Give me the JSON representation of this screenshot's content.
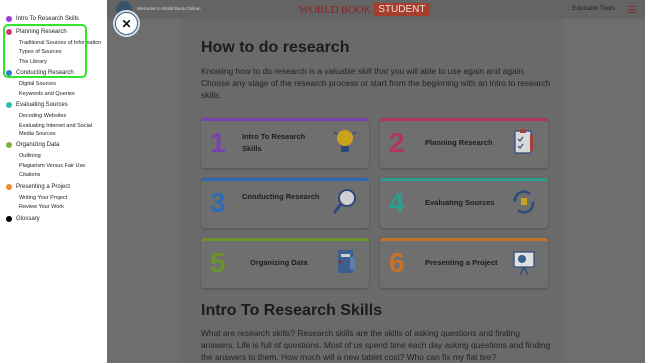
{
  "sidebar": {
    "sections": [
      {
        "label": "Intro To Research Skills",
        "color": "#9b3fd6",
        "items": []
      },
      {
        "label": "Planning Research",
        "color": "#d6357a",
        "items": [
          "Traditional Sources of Information",
          "Types of Sources",
          "The Library"
        ]
      },
      {
        "label": "Conducting Research",
        "color": "#2f7ad6",
        "items": [
          "Digital Sources",
          "Keywords and Queries"
        ]
      },
      {
        "label": "Evaluating Sources",
        "color": "#2bbfad",
        "items": [
          "Decoding Websites",
          "Evaluating Internet and Social Media Sources"
        ]
      },
      {
        "label": "Organizing Data",
        "color": "#7fb03a",
        "items": [
          "Outlining",
          "Plagiarism Versus Fair Use",
          "Citations"
        ]
      },
      {
        "label": "Presenting a Project",
        "color": "#ef8a2e",
        "items": [
          "Writing Your Project",
          "Review Your Work"
        ]
      },
      {
        "label": "Glossary",
        "color": "#000000",
        "items": []
      }
    ]
  },
  "topbar": {
    "welcome": "Welcome to World Book Online!",
    "brand": "WORLD BOOK",
    "brand_badge": "STUDENT",
    "educator_tools": "Educator Tools"
  },
  "close_label": "✕",
  "main": {
    "title": "How to do research",
    "intro": "Knowing how to do research is a valuable skill that you will able to use again and again. Choose any stage of the research process or start from the beginning with an intro to research skills.",
    "cards": [
      {
        "number": "1",
        "label": "Intro To Research Skills",
        "color": "#7a3fb0",
        "icon": "lightbulb-icon"
      },
      {
        "number": "2",
        "label": "Planning Research",
        "color": "#b0355f",
        "icon": "clipboard-icon"
      },
      {
        "number": "3",
        "label": "Conducting Research",
        "color": "#2e6bb4",
        "icon": "magnifier-icon"
      },
      {
        "number": "4",
        "label": "Evaluating Sources",
        "color": "#2a9f90",
        "icon": "refresh-thumbs-icon"
      },
      {
        "number": "5",
        "label": "Organizing Data",
        "color": "#6a9330",
        "icon": "notebook-icon"
      },
      {
        "number": "6",
        "label": "Presenting a Project",
        "color": "#c4712a",
        "icon": "presentation-board-icon"
      }
    ],
    "section2_title": "Intro To Research Skills",
    "section2_text": "What are research skills? Research skills are the skills of asking questions and finding answers. Life is full of questions. Most of us spend time each day asking questions and finding the answers to them. How much will a new tablet cost? Who can fix my flat tire?"
  }
}
